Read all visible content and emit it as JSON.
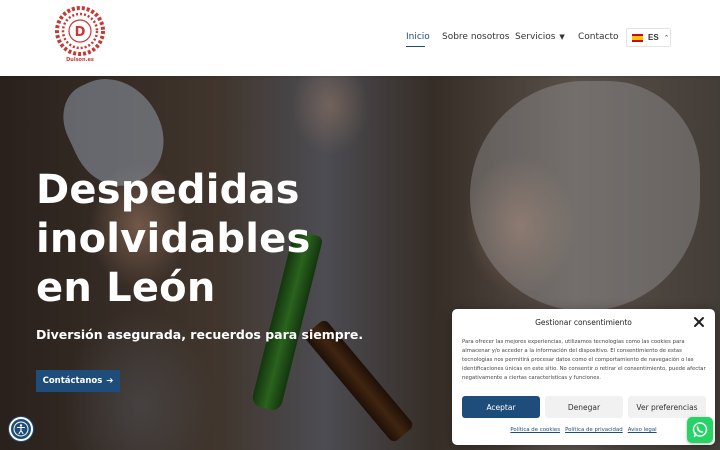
{
  "header": {
    "logo_text": "Dulson.es",
    "logo_letter": "D",
    "nav": [
      {
        "label": "Inicio",
        "active": true
      },
      {
        "label": "Sobre nosotros"
      },
      {
        "label": "Servicios",
        "has_dropdown": true
      },
      {
        "label": "Contacto"
      }
    ],
    "language": {
      "code": "ES",
      "flag": "spain-flag-icon"
    }
  },
  "hero": {
    "title": "Despedidas inolvidables en León",
    "subtitle": "Diversión asegurada, recuerdos para siempre.",
    "cta_label": "Contáctanos",
    "cta_icon": "arrow-right-icon"
  },
  "cookie": {
    "title": "Gestionar consentimiento",
    "body": "Para ofrecer las mejores experiencias, utilizamos tecnologías como las cookies para almacenar y/o acceder a la información del dispositivo. El consentimiento de estas tecnologías nos permitirá procesar datos como el comportamiento de navegación o las identificaciones únicas en este sitio. No consentir o retirar el consentimiento, puede afectar negativamente a ciertas características y funciones.",
    "accept": "Aceptar",
    "deny": "Denegar",
    "preferences": "Ver preferencias",
    "links": [
      "Política de cookies",
      "Política de privacidad",
      "Aviso legal"
    ]
  },
  "colors": {
    "brand_blue": "#1e4d7b",
    "logo_red": "#c53a35",
    "whatsapp_green": "#25d366"
  }
}
